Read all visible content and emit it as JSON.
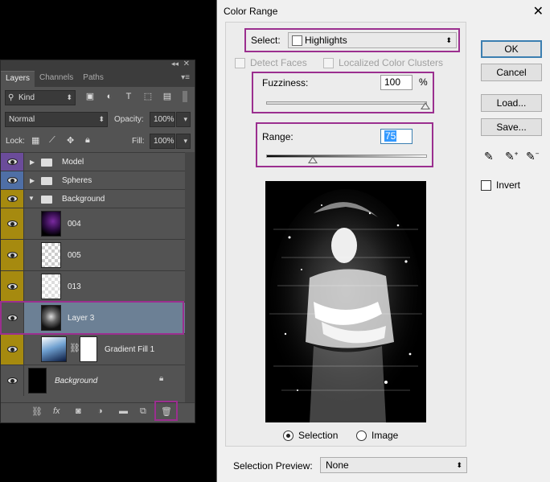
{
  "layers_panel": {
    "tabs": [
      "Layers",
      "Channels",
      "Paths"
    ],
    "filter_kind": "Kind",
    "blend_mode": "Normal",
    "opacity_label": "Opacity:",
    "opacity_value": "100%",
    "lock_label": "Lock:",
    "fill_label": "Fill:",
    "fill_value": "100%",
    "layers": [
      {
        "name": "Model",
        "type": "group",
        "eye_color": "#6b4c9a"
      },
      {
        "name": "Spheres",
        "type": "group",
        "eye_color": "#4f6fa6"
      },
      {
        "name": "Background",
        "type": "group-open",
        "eye_color": "#a68a0f"
      },
      {
        "name": "004",
        "type": "layer",
        "eye_color": "#a68a0f"
      },
      {
        "name": "005",
        "type": "layer",
        "eye_color": "#a68a0f"
      },
      {
        "name": "013",
        "type": "layer",
        "eye_color": "#a68a0f"
      },
      {
        "name": "Layer 3",
        "type": "layer",
        "eye_color": "#a68a0f",
        "selected": true
      },
      {
        "name": "Gradient Fill 1",
        "type": "fill",
        "eye_color": "#a68a0f"
      },
      {
        "name": "Background",
        "type": "locked",
        "eye_color": "#535353"
      }
    ]
  },
  "dialog": {
    "title": "Color Range",
    "select_label": "Select:",
    "select_value": "Highlights",
    "detect_faces": "Detect Faces",
    "localized": "Localized Color Clusters",
    "fuzziness_label": "Fuzziness:",
    "fuzziness_value": "100",
    "percent": "%",
    "range_label": "Range:",
    "range_value": "75",
    "radio_selection": "Selection",
    "radio_image": "Image",
    "preview_label": "Selection Preview:",
    "preview_value": "None",
    "btn_ok": "OK",
    "btn_cancel": "Cancel",
    "btn_load": "Load...",
    "btn_save": "Save...",
    "invert": "Invert"
  },
  "colors": {
    "highlight": "#9b2f8f",
    "selected_row": "#6c8095"
  }
}
